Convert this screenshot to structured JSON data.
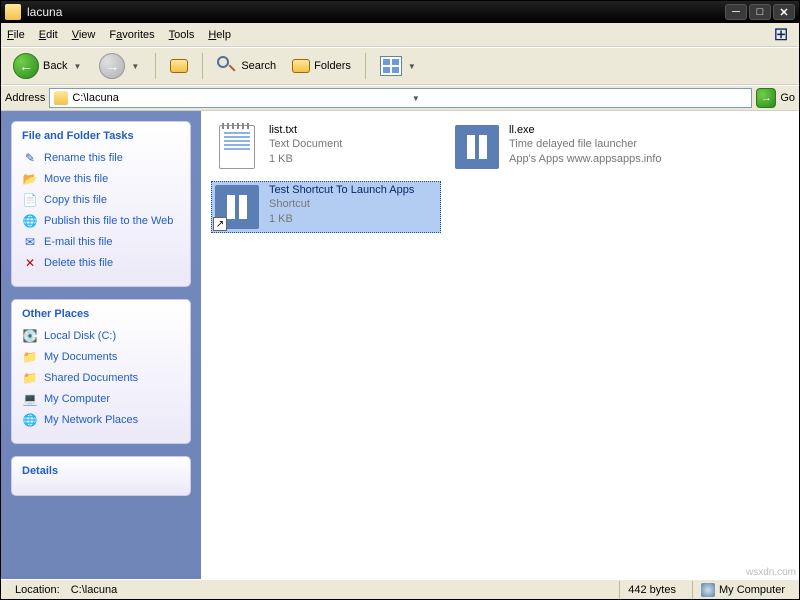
{
  "window": {
    "title": "lacuna"
  },
  "menu": {
    "file": "File",
    "edit": "Edit",
    "view": "View",
    "favorites": "Favorites",
    "tools": "Tools",
    "help": "Help"
  },
  "toolbar": {
    "back": "Back",
    "search": "Search",
    "folders": "Folders"
  },
  "address": {
    "label": "Address",
    "path": "C:\\lacuna",
    "go": "Go"
  },
  "panels": {
    "tasks": {
      "title": "File and Folder Tasks",
      "items": [
        "Rename this file",
        "Move this file",
        "Copy this file",
        "Publish this file to the Web",
        "E-mail this file",
        "Delete this file"
      ]
    },
    "places": {
      "title": "Other Places",
      "items": [
        "Local Disk (C:)",
        "My Documents",
        "Shared Documents",
        "My Computer",
        "My Network Places"
      ]
    },
    "details": {
      "title": "Details"
    }
  },
  "files": [
    {
      "name": "list.txt",
      "type": "Text Document",
      "size": "1 KB",
      "icon": "text",
      "selected": false
    },
    {
      "name": "ll.exe",
      "type": "Time delayed file launcher",
      "size": "App's Apps  www.appsapps.info",
      "icon": "exe",
      "selected": false
    },
    {
      "name": "Test Shortcut To Launch Apps",
      "type": "Shortcut",
      "size": "1 KB",
      "icon": "shortcut",
      "selected": true
    }
  ],
  "status": {
    "location_label": "Location:",
    "location": "C:\\lacuna",
    "bytes": "442 bytes",
    "computer": "My Computer"
  },
  "watermark": "wsxdn.com"
}
